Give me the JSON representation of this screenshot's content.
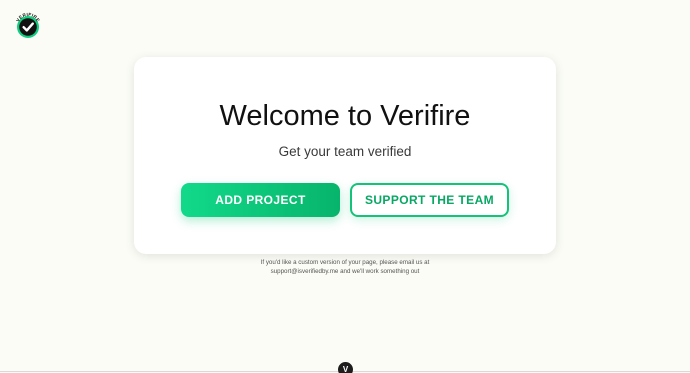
{
  "brand": {
    "logo_text": "VERIFIRE",
    "accent_color": "#0fcf80"
  },
  "hero": {
    "title": "Welcome to Verifire",
    "subtitle": "Get your team verified",
    "primary_button_label": "ADD PROJECT",
    "secondary_button_label": "SUPPORT THE TEAM"
  },
  "footer": {
    "note_line1": "If you'd like a custom version of your page, please email us at",
    "note_line2": "support@isverifiedby.me and we'll work something out",
    "badge_label": "V"
  }
}
